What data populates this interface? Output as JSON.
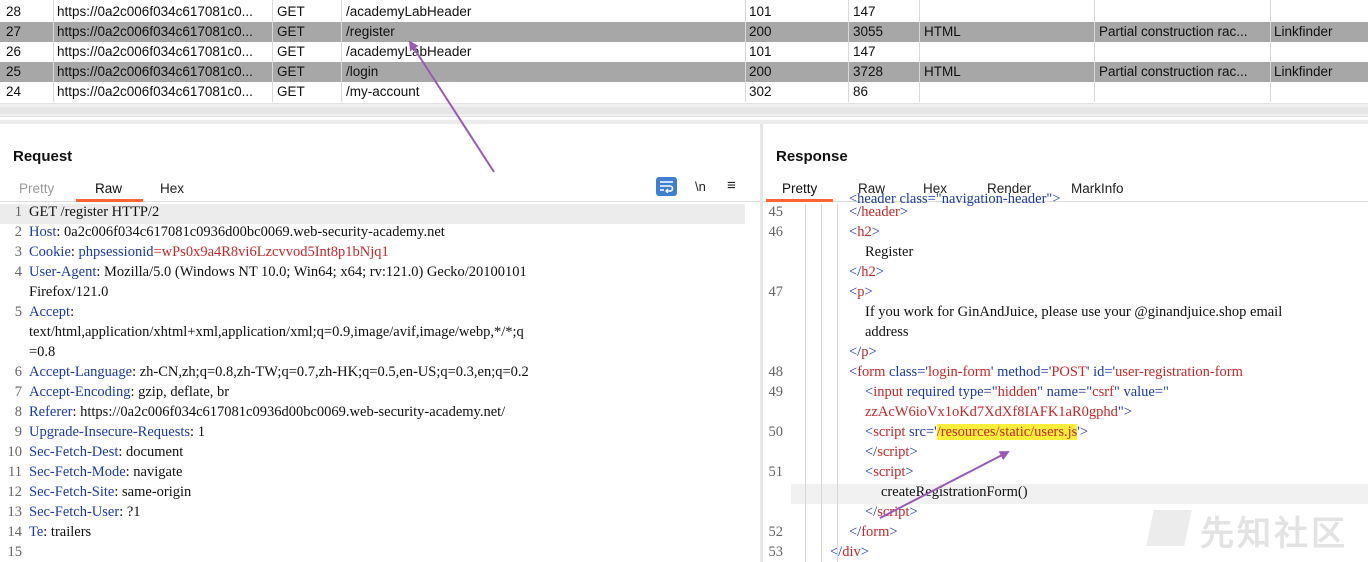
{
  "history": {
    "rows": [
      {
        "num": "28",
        "host": "https://0a2c006f034c617081c0...",
        "method": "GET",
        "url": "/academyLabHeader",
        "status": "101",
        "length": "147",
        "mime": "",
        "title": "",
        "extension": "",
        "selected": false
      },
      {
        "num": "27",
        "host": "https://0a2c006f034c617081c0...",
        "method": "GET",
        "url": "/register",
        "status": "200",
        "length": "3055",
        "mime": "HTML",
        "title": "Partial construction rac...",
        "extension": "Linkfinder",
        "selected": true
      },
      {
        "num": "26",
        "host": "https://0a2c006f034c617081c0...",
        "method": "GET",
        "url": "/academyLabHeader",
        "status": "101",
        "length": "147",
        "mime": "",
        "title": "",
        "extension": "",
        "selected": false
      },
      {
        "num": "25",
        "host": "https://0a2c006f034c617081c0...",
        "method": "GET",
        "url": "/login",
        "status": "200",
        "length": "3728",
        "mime": "HTML",
        "title": "Partial construction rac...",
        "extension": "Linkfinder",
        "selected": true
      },
      {
        "num": "24",
        "host": "https://0a2c006f034c617081c0...",
        "method": "GET",
        "url": "/my-account",
        "status": "302",
        "length": "86",
        "mime": "",
        "title": "",
        "extension": "",
        "selected": false
      }
    ]
  },
  "request": {
    "title": "Request",
    "tabs": [
      "Pretty",
      "Raw",
      "Hex"
    ],
    "active_tab": "Raw",
    "newline_label": "\\n",
    "menu_label": "≡",
    "lines": [
      {
        "n": "1",
        "parts": [
          {
            "t": "GET /register HTTP/2"
          }
        ]
      },
      {
        "n": "2",
        "parts": [
          {
            "t": "Host",
            "c": "hk"
          },
          {
            "t": ": 0a2c006f034c617081c0936d00bc0069.web-security-academy.net"
          }
        ]
      },
      {
        "n": "3",
        "parts": [
          {
            "t": "Cookie",
            "c": "hk"
          },
          {
            "t": ": "
          },
          {
            "t": "phpsessionid",
            "c": "hk"
          },
          {
            "t": "=wPs0x9a4R8vi6Lzcvvod5Int8p1bNjq1",
            "c": "cval"
          }
        ]
      },
      {
        "n": "4",
        "parts": [
          {
            "t": "User-Agent",
            "c": "hk"
          },
          {
            "t": ": Mozilla/5.0 (Windows NT 10.0; Win64; x64; rv:121.0) Gecko/20100101"
          }
        ]
      },
      {
        "n": "",
        "parts": [
          {
            "t": "Firefox/121.0"
          }
        ]
      },
      {
        "n": "5",
        "parts": [
          {
            "t": "Accept",
            "c": "hk"
          },
          {
            "t": ":"
          }
        ]
      },
      {
        "n": "",
        "parts": [
          {
            "t": "text/html,application/xhtml+xml,application/xml;q=0.9,image/avif,image/webp,*/*;q"
          }
        ]
      },
      {
        "n": "",
        "parts": [
          {
            "t": "=0.8"
          }
        ]
      },
      {
        "n": "6",
        "parts": [
          {
            "t": "Accept-Language",
            "c": "hk"
          },
          {
            "t": ": zh-CN,zh;q=0.8,zh-TW;q=0.7,zh-HK;q=0.5,en-US;q=0.3,en;q=0.2"
          }
        ]
      },
      {
        "n": "7",
        "parts": [
          {
            "t": "Accept-Encoding",
            "c": "hk"
          },
          {
            "t": ": gzip, deflate, br"
          }
        ]
      },
      {
        "n": "8",
        "parts": [
          {
            "t": "Referer",
            "c": "hk"
          },
          {
            "t": ": https://0a2c006f034c617081c0936d00bc0069.web-security-academy.net/"
          }
        ]
      },
      {
        "n": "9",
        "parts": [
          {
            "t": "Upgrade-Insecure-Requests",
            "c": "hk"
          },
          {
            "t": ": 1"
          }
        ]
      },
      {
        "n": "10",
        "parts": [
          {
            "t": "Sec-Fetch-Dest",
            "c": "hk"
          },
          {
            "t": ": document"
          }
        ]
      },
      {
        "n": "11",
        "parts": [
          {
            "t": "Sec-Fetch-Mode",
            "c": "hk"
          },
          {
            "t": ": navigate"
          }
        ]
      },
      {
        "n": "12",
        "parts": [
          {
            "t": "Sec-Fetch-Site",
            "c": "hk"
          },
          {
            "t": ": same-origin"
          }
        ]
      },
      {
        "n": "13",
        "parts": [
          {
            "t": "Sec-Fetch-User",
            "c": "hk"
          },
          {
            "t": ": ?1"
          }
        ]
      },
      {
        "n": "14",
        "parts": [
          {
            "t": "Te",
            "c": "hk"
          },
          {
            "t": ": trailers"
          }
        ]
      },
      {
        "n": "15",
        "parts": []
      }
    ]
  },
  "response": {
    "title": "Response",
    "tabs": [
      "Pretty",
      "Raw",
      "Hex",
      "Render",
      "MarkInfo"
    ],
    "active_tab": "Pretty",
    "partial_top": "<header class=\"navigation-header\">",
    "lines": [
      {
        "n": "45",
        "indent": 1,
        "parts": [
          {
            "t": "</",
            "c": "tg"
          },
          {
            "t": "header",
            "c": "at"
          },
          {
            "t": ">",
            "c": "tg"
          }
        ]
      },
      {
        "n": "46",
        "indent": 1,
        "parts": [
          {
            "t": "<",
            "c": "tg"
          },
          {
            "t": "h2",
            "c": "at"
          },
          {
            "t": ">",
            "c": "tg"
          }
        ]
      },
      {
        "n": "",
        "indent": 2,
        "parts": [
          {
            "t": "Register"
          }
        ]
      },
      {
        "n": "",
        "indent": 1,
        "parts": [
          {
            "t": "</",
            "c": "tg"
          },
          {
            "t": "h2",
            "c": "at"
          },
          {
            "t": ">",
            "c": "tg"
          }
        ]
      },
      {
        "n": "47",
        "indent": 1,
        "parts": [
          {
            "t": "<",
            "c": "tg"
          },
          {
            "t": "p",
            "c": "at"
          },
          {
            "t": ">",
            "c": "tg"
          }
        ]
      },
      {
        "n": "",
        "indent": 2,
        "parts": [
          {
            "t": "If you work for GinAndJuice, please use your @ginandjuice.shop email"
          }
        ]
      },
      {
        "n": "",
        "indent": 2,
        "parts": [
          {
            "t": "address"
          }
        ]
      },
      {
        "n": "",
        "indent": 1,
        "parts": [
          {
            "t": "</",
            "c": "tg"
          },
          {
            "t": "p",
            "c": "at"
          },
          {
            "t": ">",
            "c": "tg"
          }
        ]
      },
      {
        "n": "48",
        "indent": 1,
        "parts": [
          {
            "t": "<",
            "c": "tg"
          },
          {
            "t": "form",
            "c": "at"
          },
          {
            "t": " class",
            "c": "av"
          },
          {
            "t": "='",
            "c": "tg"
          },
          {
            "t": "login-form",
            "c": "at"
          },
          {
            "t": "' ",
            "c": "tg"
          },
          {
            "t": "method",
            "c": "av"
          },
          {
            "t": "='",
            "c": "tg"
          },
          {
            "t": "POST",
            "c": "at"
          },
          {
            "t": "' ",
            "c": "tg"
          },
          {
            "t": "id",
            "c": "av"
          },
          {
            "t": "='",
            "c": "tg"
          },
          {
            "t": "user-registration-form",
            "c": "at"
          }
        ]
      },
      {
        "n": "49",
        "indent": 2,
        "parts": [
          {
            "t": "<",
            "c": "tg"
          },
          {
            "t": "input",
            "c": "at"
          },
          {
            "t": " required type",
            "c": "av"
          },
          {
            "t": "=\"",
            "c": "tg"
          },
          {
            "t": "hidden",
            "c": "at"
          },
          {
            "t": "\" ",
            "c": "tg"
          },
          {
            "t": "name",
            "c": "av"
          },
          {
            "t": "=\"",
            "c": "tg"
          },
          {
            "t": "csrf",
            "c": "at"
          },
          {
            "t": "\" ",
            "c": "tg"
          },
          {
            "t": "value",
            "c": "av"
          },
          {
            "t": "=\"",
            "c": "tg"
          }
        ]
      },
      {
        "n": "",
        "indent": 2,
        "parts": [
          {
            "t": "zzAcW6ioVx1oKd7XdXf8IAFK1aR0gphd",
            "c": "at"
          },
          {
            "t": "\">",
            "c": "tg"
          }
        ]
      },
      {
        "n": "50",
        "indent": 2,
        "parts": [
          {
            "t": "<",
            "c": "tg"
          },
          {
            "t": "script",
            "c": "at"
          },
          {
            "t": " src",
            "c": "av"
          },
          {
            "t": "='",
            "c": "tg"
          },
          {
            "t": "/resources/static/users.js",
            "c": "at",
            "hl": true
          },
          {
            "t": "'>",
            "c": "tg"
          }
        ]
      },
      {
        "n": "",
        "indent": 2,
        "parts": [
          {
            "t": "</",
            "c": "tg"
          },
          {
            "t": "script",
            "c": "at"
          },
          {
            "t": ">",
            "c": "tg"
          }
        ]
      },
      {
        "n": "51",
        "indent": 2,
        "parts": [
          {
            "t": "<",
            "c": "tg"
          },
          {
            "t": "script",
            "c": "at"
          },
          {
            "t": ">",
            "c": "tg"
          }
        ]
      },
      {
        "n": "",
        "indent": 3,
        "cursor": true,
        "parts": [
          {
            "t": "createRegistrationForm()"
          }
        ]
      },
      {
        "n": "",
        "indent": 2,
        "parts": [
          {
            "t": "</",
            "c": "tg"
          },
          {
            "t": "script",
            "c": "at"
          },
          {
            "t": ">",
            "c": "tg"
          }
        ]
      },
      {
        "n": "52",
        "indent": 1,
        "parts": [
          {
            "t": "</",
            "c": "tg"
          },
          {
            "t": "form",
            "c": "at"
          },
          {
            "t": ">",
            "c": "tg"
          }
        ]
      },
      {
        "n": "53",
        "indent": 0,
        "parts": [
          {
            "t": "</",
            "c": "tg"
          },
          {
            "t": "div",
            "c": "at"
          },
          {
            "t": ">",
            "c": "tg"
          }
        ]
      }
    ]
  },
  "watermark": {
    "text": "先知社区"
  },
  "colors": {
    "selected_row": "#a7a7a7",
    "tab_accent": "#ff6633",
    "highlight": "#ffef3a",
    "annotation_arrow": "#9b59b6",
    "header_key": "#1a3aa8",
    "cookie_value": "#c62828"
  },
  "icons": [
    "word-wrap-icon",
    "newline-icon",
    "menu-icon",
    "arrow-annotation-icon"
  ]
}
